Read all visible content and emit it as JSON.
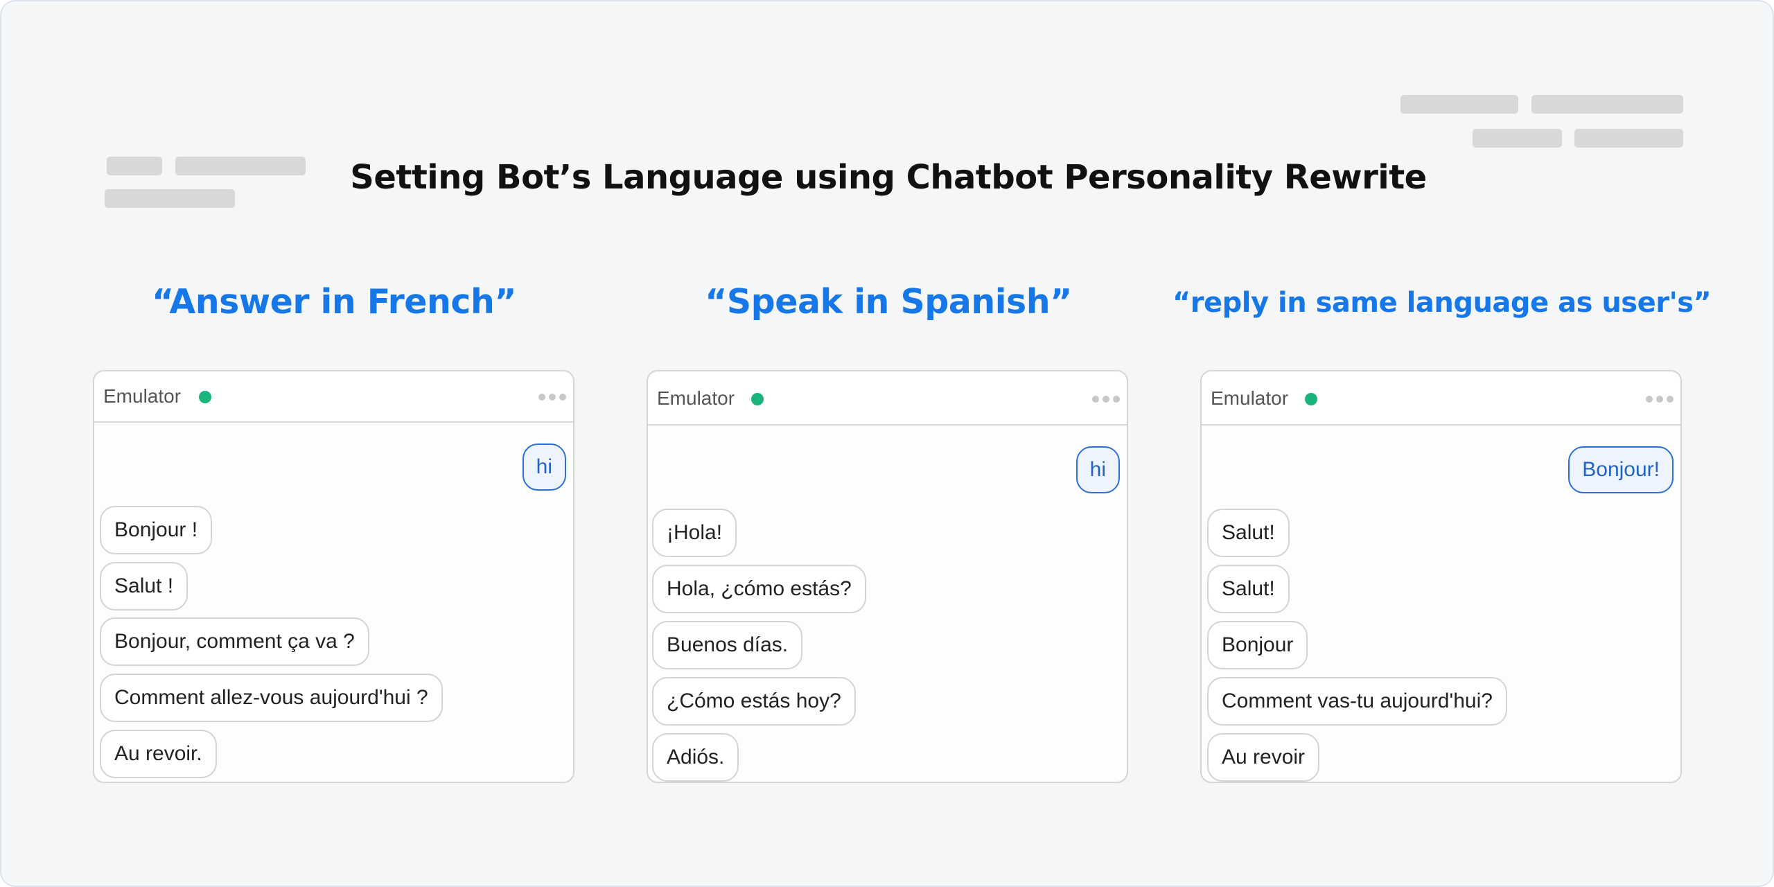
{
  "title": "Setting Bot’s Language using Chatbot Personality Rewrite",
  "columns": [
    {
      "heading": "“Answer in French”",
      "panel": {
        "title": "Emulator",
        "status": "online",
        "user_message": "hi",
        "bot_messages": [
          "Bonjour !",
          "Salut !",
          "Bonjour, comment ça va ?",
          "Comment allez-vous aujourd'hui ?",
          "Au revoir."
        ]
      }
    },
    {
      "heading": "“Speak in Spanish”",
      "panel": {
        "title": "Emulator",
        "status": "online",
        "user_message": "hi",
        "bot_messages": [
          "¡Hola!",
          "Hola, ¿cómo estás?",
          "Buenos días.",
          "¿Cómo estás hoy?",
          "Adiós."
        ]
      }
    },
    {
      "heading": "“reply in same language as user's”",
      "panel": {
        "title": "Emulator",
        "status": "online",
        "user_message": "Bonjour!",
        "bot_messages": [
          "Salut!",
          "Salut!",
          "Bonjour",
          "Comment vas-tu aujourd'hui?",
          "Au revoir"
        ]
      }
    }
  ],
  "colors": {
    "accent": "#1677e8",
    "status_online": "#17b57a",
    "user_bubble_border": "#2c6fd6",
    "placeholder": "#d8d8d8"
  },
  "icons": {
    "status": "status-dot-icon",
    "menu": "more-options-icon"
  }
}
